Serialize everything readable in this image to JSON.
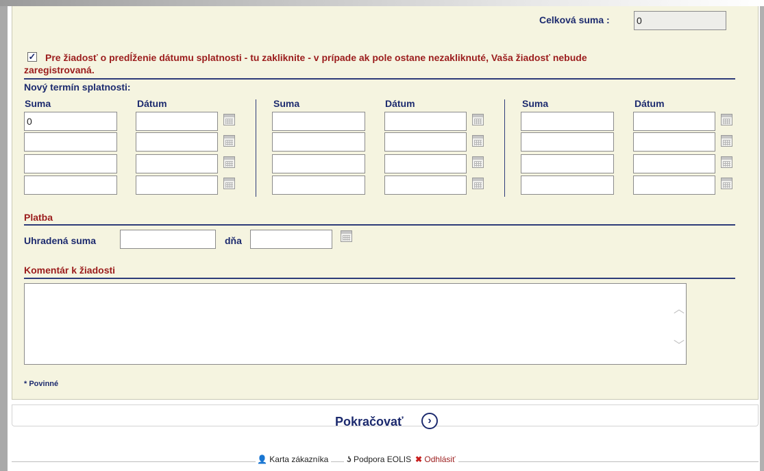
{
  "total": {
    "label": "Celková suma :",
    "value": "0"
  },
  "consent": {
    "checked": true,
    "text_line1": "Pre žiadosť o predĺženie dátumu splatnosti - tu zakliknite - v prípade ak pole ostane nezakliknuté, Vaša žiadosť nebude",
    "text_line2": "zaregistrovaná."
  },
  "schedule": {
    "title": "Nový termín splatnosti:",
    "amount_header": "Suma",
    "date_header": "Dátum",
    "first_amount": "0",
    "rows_per_column": 4,
    "columns": 3
  },
  "payment": {
    "section_title": "Platba",
    "amount_label": "Uhradená suma",
    "day_label": "dňa",
    "amount_value": "",
    "day_value": ""
  },
  "comment": {
    "section_title": "Komentár k žiadosti",
    "value": ""
  },
  "required_note": "* Povinné",
  "actions": {
    "continue_label": "Pokračovať"
  },
  "footer": {
    "customer_card": "Karta zákazníka",
    "support": "Podpora EOLIS",
    "logout": "Odhlásiť"
  },
  "colors": {
    "label_blue": "#1c2a6e",
    "accent_red": "#9b1c1c",
    "panel_bg": "#f5f4e0"
  },
  "icons": [
    "calendar-icon",
    "checkbox-checked-icon",
    "chevron-right-icon",
    "customer-card-icon",
    "support-icon",
    "logout-icon"
  ]
}
